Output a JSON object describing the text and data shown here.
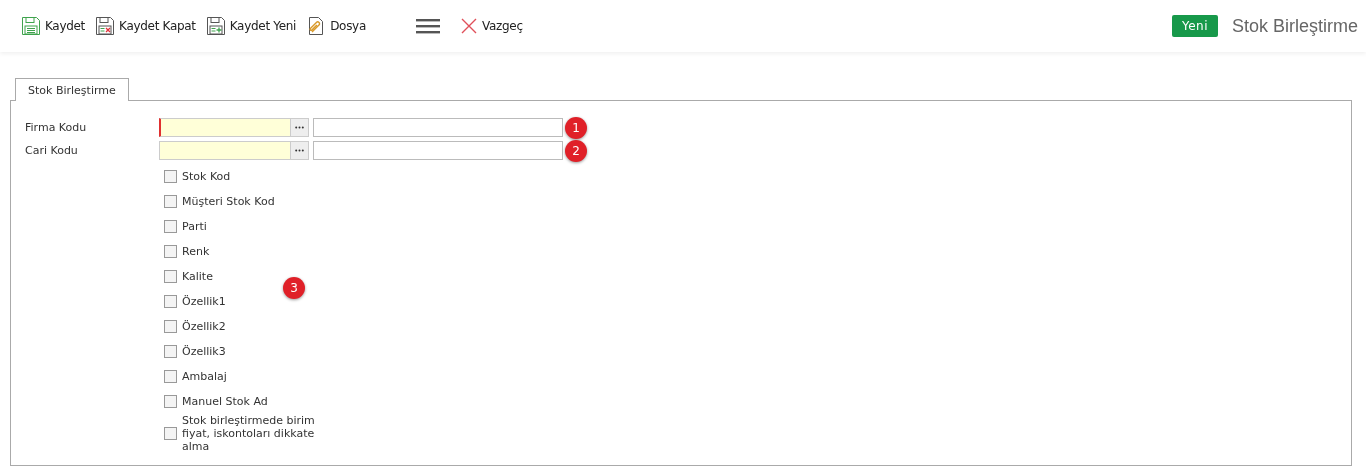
{
  "toolbar": {
    "buttons": [
      {
        "kind": "save",
        "label": "Kaydet"
      },
      {
        "kind": "save-close",
        "label": "Kaydet Kapat"
      },
      {
        "kind": "save-new",
        "label": "Kaydet Yeni"
      },
      {
        "kind": "file",
        "label": "Dosya"
      },
      {
        "kind": "menu"
      },
      {
        "kind": "cancel",
        "label": "Vazgeç"
      }
    ],
    "badge": "Yeni",
    "title": "Stok Birleştirme"
  },
  "tabs": [
    {
      "label": "Stok Birleştirme",
      "selected": true
    }
  ],
  "fields": [
    {
      "label": "Firma Kodu",
      "required": true,
      "marker": "1"
    },
    {
      "label": "Cari Kodu",
      "required": false,
      "marker": "2"
    }
  ],
  "options": [
    {
      "label": "Stok Kod",
      "checked": false
    },
    {
      "label": "Müşteri Stok Kod",
      "checked": false
    },
    {
      "label": "Parti",
      "checked": false
    },
    {
      "label": "Renk",
      "checked": false
    },
    {
      "label": "Kalite",
      "checked": false
    },
    {
      "label": "Özellik1",
      "checked": false
    },
    {
      "label": "Özellik2",
      "checked": false
    },
    {
      "label": "Özellik3",
      "checked": false
    },
    {
      "label": "Ambalaj",
      "checked": false
    },
    {
      "label": "Manuel Stok Ad",
      "checked": false
    },
    {
      "label": "Stok birleştirmede birim fiyat, iskontoları dikkate alma",
      "checked": false
    }
  ],
  "floating_marker": "3"
}
